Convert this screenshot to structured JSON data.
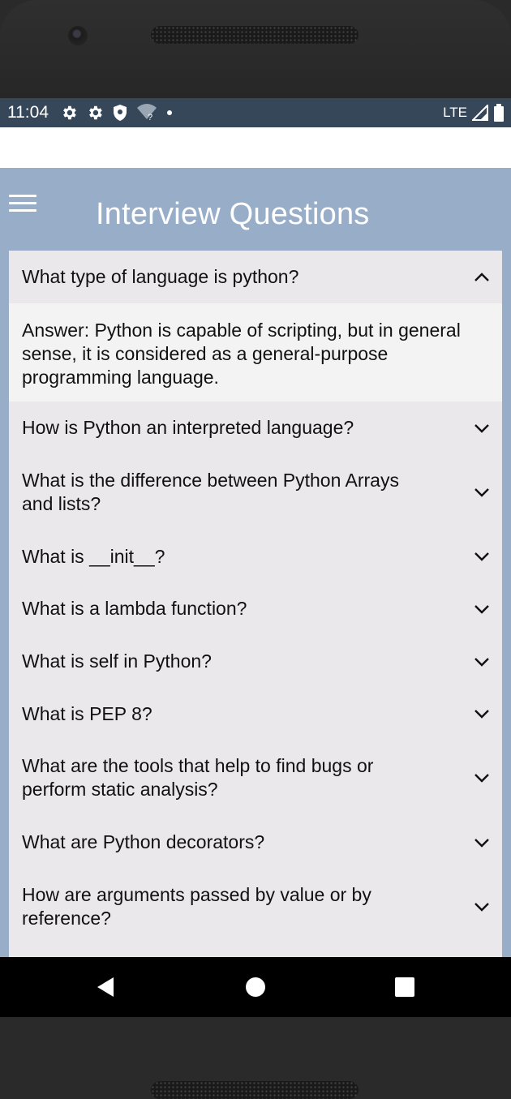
{
  "status_bar": {
    "time": "11:04",
    "network": "LTE",
    "icons": [
      "settings-icon",
      "settings-icon",
      "shield-icon",
      "wifi-unknown-icon",
      "dot-icon",
      "signal-icon",
      "battery-icon"
    ]
  },
  "app": {
    "title": "Interview Questions",
    "menu_icon": "hamburger-menu-icon"
  },
  "questions": [
    {
      "text": "What type of language is python?",
      "expanded": true,
      "answer": "Answer: Python is capable of scripting, but in general sense, it is considered as a general-purpose programming language."
    },
    {
      "text": "How is Python an interpreted language?",
      "expanded": false
    },
    {
      "text": "What is the difference between Python Arrays and lists?",
      "expanded": false
    },
    {
      "text": "What is __init__?",
      "expanded": false
    },
    {
      "text": "What is a lambda function?",
      "expanded": false
    },
    {
      "text": "What is self in Python?",
      "expanded": false
    },
    {
      "text": "What is PEP 8?",
      "expanded": false
    },
    {
      "text": "What are the tools that help to find bugs or perform static analysis?",
      "expanded": false
    },
    {
      "text": "What are Python decorators?",
      "expanded": false
    },
    {
      "text": "How are arguments passed by value or by reference?",
      "expanded": false
    }
  ],
  "nav_bar": {
    "buttons": [
      "back-icon",
      "home-icon",
      "recents-icon"
    ]
  },
  "colors": {
    "status_bar": "#37475a",
    "app_background": "#97adc8",
    "accordion_background": "#ebe8ec",
    "answer_background": "#f3f3f4"
  }
}
